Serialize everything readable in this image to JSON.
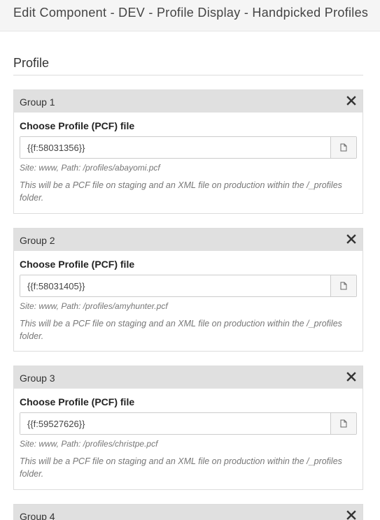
{
  "modal": {
    "title": "Edit Component - DEV - Profile Display - Handpicked Profiles"
  },
  "section": {
    "title": "Profile"
  },
  "groups": [
    {
      "title": "Group 1",
      "field_label": "Choose Profile (PCF) file",
      "value": "{{f:58031356}}",
      "site_path": "Site: www, Path: /profiles/abayomi.pcf",
      "note": "This will be a PCF file on staging and an XML file on production within the /_profiles folder."
    },
    {
      "title": "Group 2",
      "field_label": "Choose Profile (PCF) file",
      "value": "{{f:58031405}}",
      "site_path": "Site: www, Path: /profiles/amyhunter.pcf",
      "note": "This will be a PCF file on staging and an XML file on production within the /_profiles folder."
    },
    {
      "title": "Group 3",
      "field_label": "Choose Profile (PCF) file",
      "value": "{{f:59527626}}",
      "site_path": "Site: www, Path: /profiles/christpe.pcf",
      "note": "This will be a PCF file on staging and an XML file on production within the /_profiles folder."
    },
    {
      "title": "Group 4"
    }
  ],
  "icons": {
    "remove": "close-icon",
    "browse": "file-icon"
  }
}
